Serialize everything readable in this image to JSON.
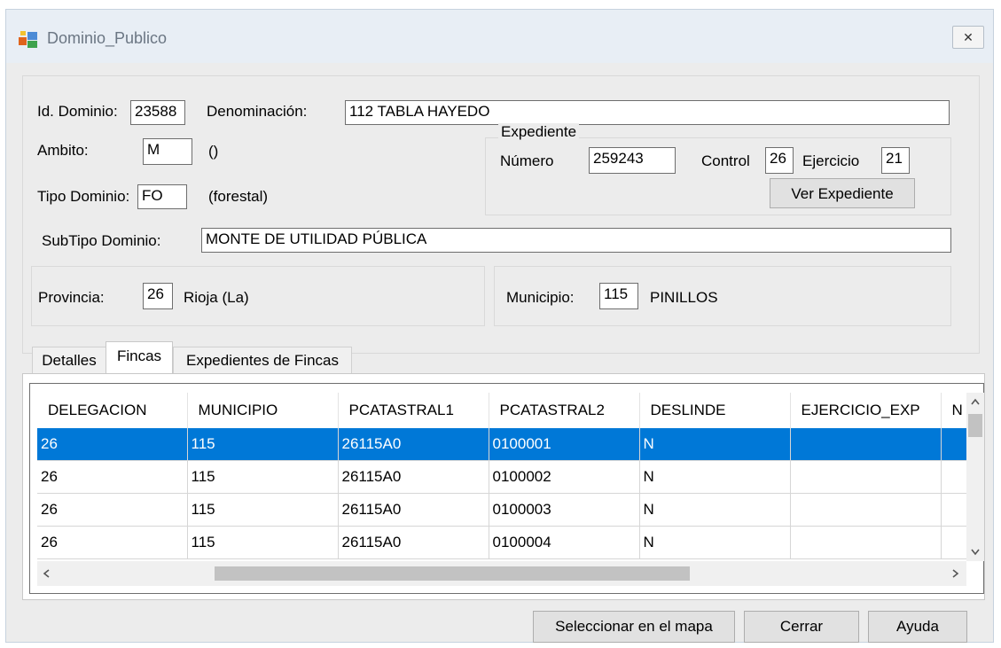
{
  "window": {
    "title": "Dominio_Publico",
    "close_symbol": "✕"
  },
  "form": {
    "id_dominio_label": "Id. Dominio:",
    "id_dominio_value": "23588",
    "denominacion_label": "Denominación:",
    "denominacion_value": "112 TABLA HAYEDO",
    "ambito_label": "Ambito:",
    "ambito_value": "M",
    "ambito_desc": "()",
    "tipo_dominio_label": "Tipo Dominio:",
    "tipo_dominio_value": "FO",
    "tipo_dominio_desc": "(forestal)",
    "subtipo_label": "SubTipo Dominio:",
    "subtipo_value": "MONTE DE UTILIDAD PÚBLICA",
    "provincia_label": "Provincia:",
    "provincia_code": "26",
    "provincia_name": "Rioja (La)",
    "municipio_label": "Municipio:",
    "municipio_code": "115",
    "municipio_name": "PINILLOS"
  },
  "expediente": {
    "group_label": "Expediente",
    "numero_label": "Número",
    "numero_value": "259243",
    "control_label": "Control",
    "control_value": "26",
    "ejercicio_label": "Ejercicio",
    "ejercicio_value": "21",
    "ver_button": "Ver Expediente"
  },
  "tabs": [
    {
      "label": "Detalles",
      "active": false
    },
    {
      "label": "Fincas",
      "active": true
    },
    {
      "label": "Expedientes de Fincas",
      "active": false
    }
  ],
  "grid": {
    "columns": [
      "DELEGACION",
      "MUNICIPIO",
      "PCATASTRAL1",
      "PCATASTRAL2",
      "DESLINDE",
      "EJERCICIO_EXP",
      "N"
    ],
    "rows": [
      [
        "26",
        "115",
        "26115A0",
        "0100001",
        "N",
        "",
        ""
      ],
      [
        "26",
        "115",
        "26115A0",
        "0100002",
        "N",
        "",
        ""
      ],
      [
        "26",
        "115",
        "26115A0",
        "0100003",
        "N",
        "",
        ""
      ],
      [
        "26",
        "115",
        "26115A0",
        "0100004",
        "N",
        "",
        ""
      ]
    ],
    "selected_row": 0
  },
  "buttons": {
    "seleccionar": "Seleccionar en el mapa",
    "cerrar": "Cerrar",
    "ayuda": "Ayuda"
  }
}
